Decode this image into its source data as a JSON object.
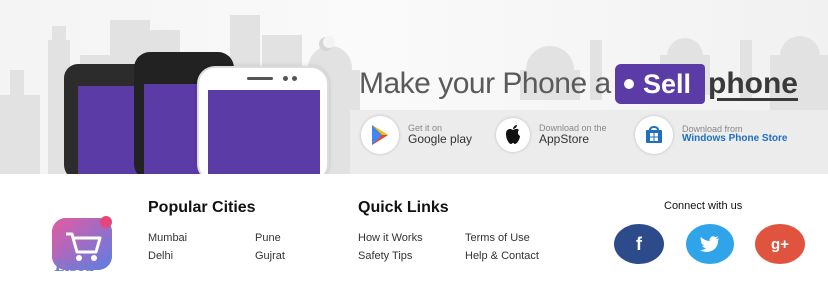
{
  "banner": {
    "headline": "Make your Phone a",
    "sell_tag": "Sell",
    "phone_word": "phone",
    "stores": [
      {
        "small": "Get it on",
        "big": "Google play",
        "icon": "google-play-icon"
      },
      {
        "small": "Download on the",
        "big": "AppStore",
        "icon": "apple-icon"
      },
      {
        "small": "Download from",
        "big": "Windows Phone Store",
        "icon": "windows-store-icon"
      }
    ]
  },
  "footer": {
    "logo_text": "Listu",
    "popular_cities": {
      "title": "Popular Cities",
      "items": [
        "Mumbai",
        "Pune",
        "Delhi",
        "Gujrat"
      ]
    },
    "quick_links": {
      "title": "Quick Links",
      "items": [
        "How it Works",
        "Terms of Use",
        "Safety Tips",
        "Help & Contact"
      ]
    },
    "connect": {
      "title": "Connect with us",
      "facebook": "f",
      "twitter": "t",
      "google_plus": "g+"
    }
  },
  "colors": {
    "purple": "#5b3ba6",
    "facebook": "#2d4b8b",
    "twitter": "#2fa4e8",
    "google_plus": "#e0533f",
    "windows_blue": "#1e6fc2"
  }
}
